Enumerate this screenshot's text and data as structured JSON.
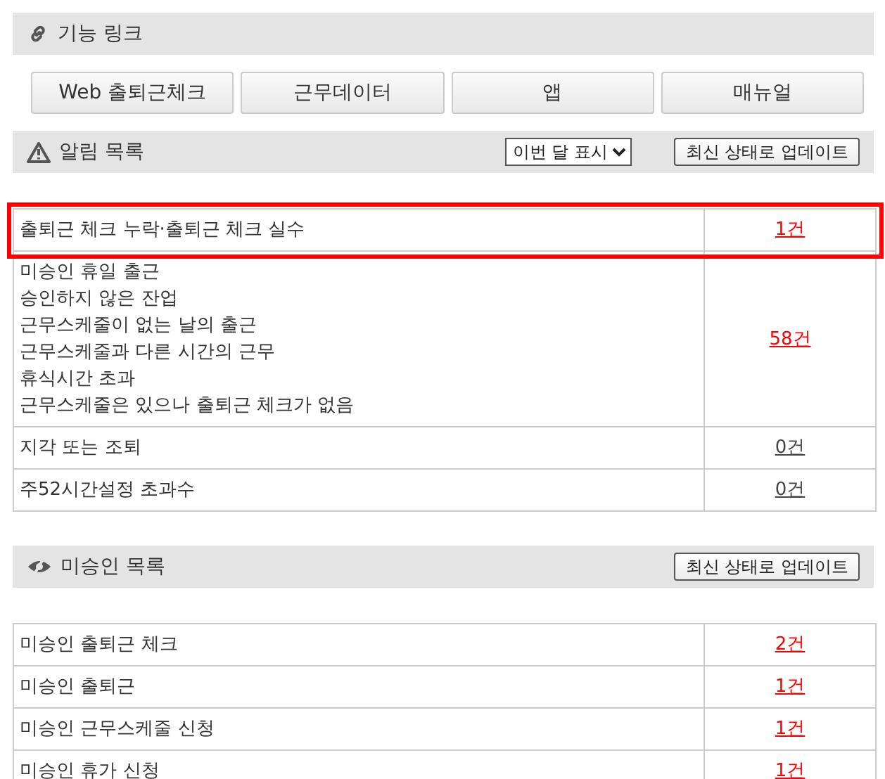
{
  "links_section": {
    "title": "기능 링크",
    "buttons": [
      "Web 출퇴근체크",
      "근무데이터",
      "앱",
      "매뉴얼"
    ]
  },
  "alerts_section": {
    "title": "알림 목록",
    "period_select": "이번 달 표시",
    "update_button": "최신 상태로 업데이트",
    "rows": [
      {
        "lines": [
          "출퇴근 체크 누락·출퇴근 체크 실수"
        ],
        "count": "1건",
        "alert": true,
        "highlighted": true
      },
      {
        "lines": [
          "미승인 휴일 출근",
          "승인하지 않은 잔업",
          "근무스케줄이 없는 날의 출근",
          "근무스케줄과 다른 시간의 근무",
          "휴식시간 초과",
          "근무스케줄은 있으나 출퇴근 체크가 없음"
        ],
        "count": "58건",
        "alert": true,
        "highlighted": false
      },
      {
        "lines": [
          "지각 또는 조퇴"
        ],
        "count": "0건",
        "alert": false,
        "highlighted": false
      },
      {
        "lines": [
          "주52시간설정 초과수"
        ],
        "count": "0건",
        "alert": false,
        "highlighted": false
      }
    ]
  },
  "unapproved_section": {
    "title": "미승인 목록",
    "update_button": "최신 상태로 업데이트",
    "rows": [
      {
        "lines": [
          "미승인 출퇴근 체크"
        ],
        "count": "2건",
        "alert": true,
        "highlighted": false
      },
      {
        "lines": [
          "미승인 출퇴근"
        ],
        "count": "1건",
        "alert": true,
        "highlighted": false
      },
      {
        "lines": [
          "미승인 근무스케줄 신청"
        ],
        "count": "1건",
        "alert": true,
        "highlighted": false
      },
      {
        "lines": [
          "미승인 휴가 신청"
        ],
        "count": "1건",
        "alert": true,
        "highlighted": false
      }
    ]
  }
}
